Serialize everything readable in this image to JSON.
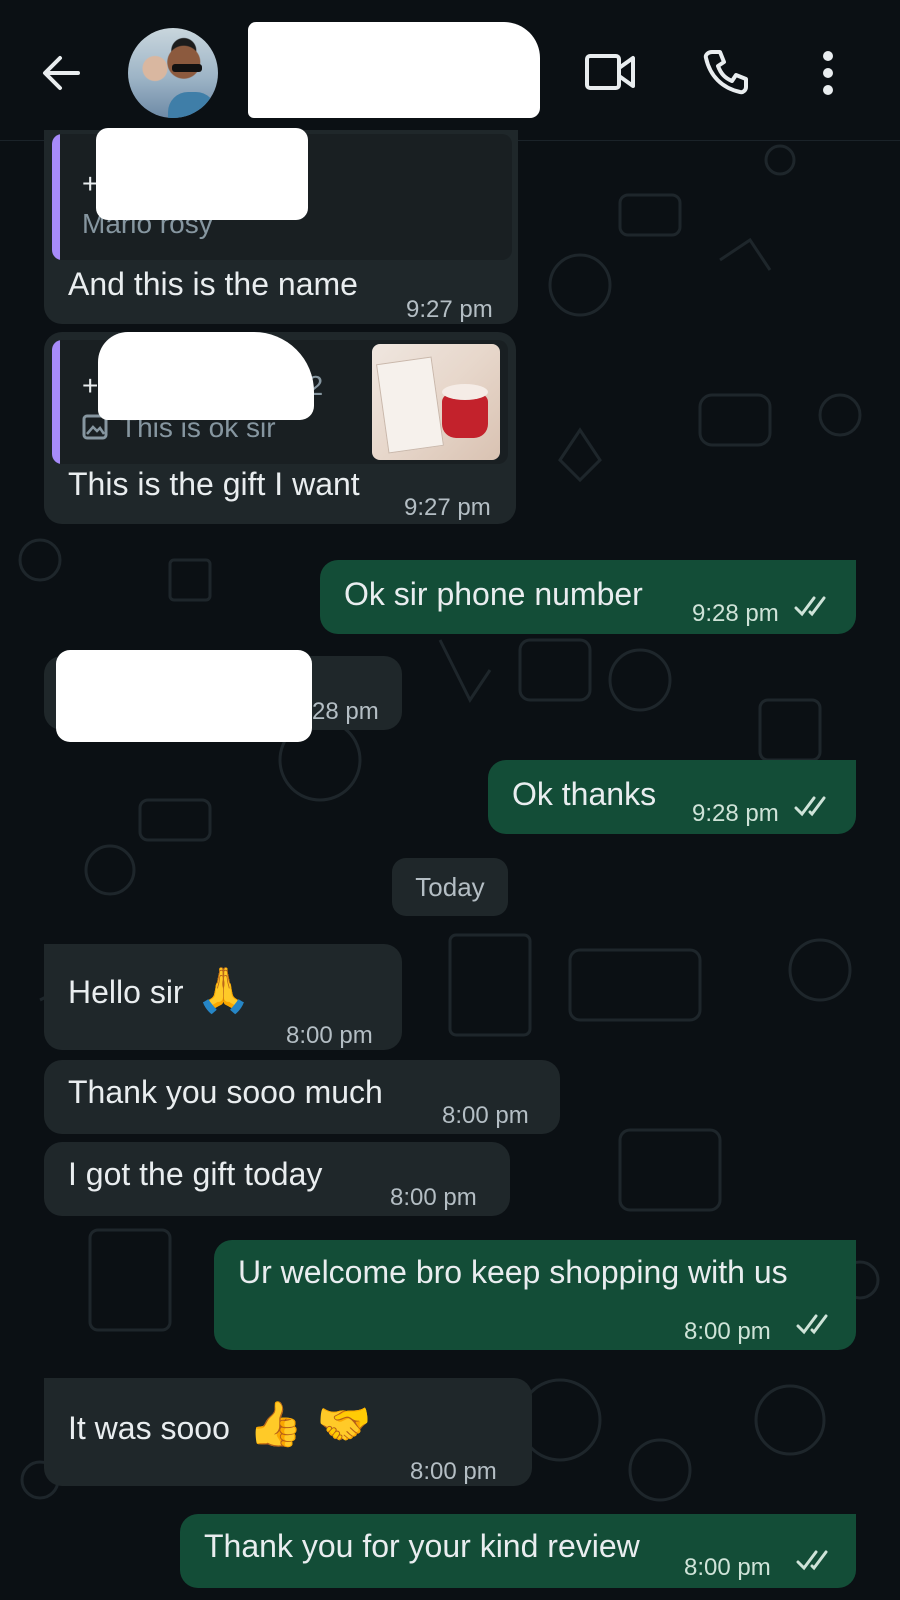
{
  "header": {
    "contact_avatar": "contact-photo",
    "icons": {
      "back": "arrow-left-icon",
      "video": "video-call-icon",
      "voice": "phone-icon",
      "menu": "more-vertical-icon"
    }
  },
  "colors": {
    "background": "#0b1014",
    "incoming_bubble": "#1f272a",
    "outgoing_bubble": "#134d37",
    "quote_bar": "#a78bfa"
  },
  "messages": [
    {
      "direction": "in",
      "quote_name": "+",
      "quote_text": "Mario rosy",
      "text": "And this is the name",
      "time": "9:27 pm"
    },
    {
      "direction": "in",
      "quote_name": "+",
      "quote_suffix": "72",
      "quote_text": "This is ok sir",
      "text": "This is the gift I want",
      "time": "9:27 pm"
    },
    {
      "direction": "out",
      "text": "Ok sir phone number",
      "time": "9:28 pm",
      "status": "read"
    },
    {
      "direction": "in",
      "text": "",
      "time": "28 pm"
    },
    {
      "direction": "out",
      "text": "Ok thanks",
      "time": "9:28 pm",
      "status": "read"
    },
    {
      "direction": "in",
      "text": "Hello sir",
      "emoji": "🙏",
      "time": "8:00 pm"
    },
    {
      "direction": "in",
      "text": "Thank you sooo much",
      "time": "8:00 pm"
    },
    {
      "direction": "in",
      "text": "I got the gift today",
      "time": "8:00 pm"
    },
    {
      "direction": "out",
      "text": "Ur welcome bro keep shopping with us",
      "time": "8:00 pm",
      "status": "read"
    },
    {
      "direction": "in",
      "text": "It was sooo",
      "emoji": "👍 🤝",
      "time": "8:00 pm"
    },
    {
      "direction": "out",
      "text": "Thank you for your kind review",
      "time": "8:00 pm",
      "status": "read"
    }
  ],
  "date_separator": "Today"
}
